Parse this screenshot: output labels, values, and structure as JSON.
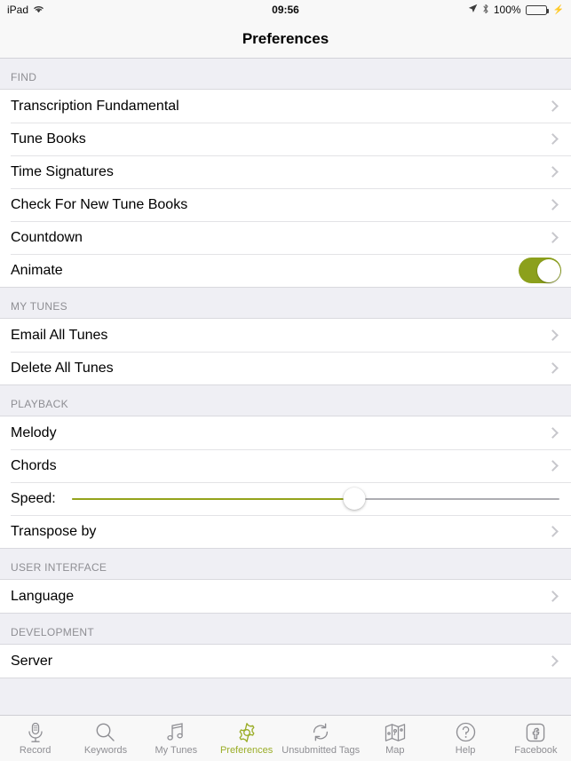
{
  "statusbar": {
    "device": "iPad",
    "wifi_icon": "wifi-icon",
    "time": "09:56",
    "location_icon": "location-arrow-icon",
    "bluetooth_icon": "bluetooth-icon",
    "battery_percent": "100%",
    "battery_icon": "battery-full-icon",
    "charging_icon": "lightning-bolt-icon"
  },
  "navbar": {
    "title": "Preferences"
  },
  "sections": [
    {
      "header": "FIND",
      "rows": [
        {
          "label": "Transcription Fundamental",
          "accessory": "chevron"
        },
        {
          "label": "Tune Books",
          "accessory": "chevron"
        },
        {
          "label": "Time Signatures",
          "accessory": "chevron"
        },
        {
          "label": "Check For New Tune Books",
          "accessory": "chevron"
        },
        {
          "label": "Countdown",
          "accessory": "chevron"
        },
        {
          "label": "Animate",
          "accessory": "toggle",
          "toggle_on": true
        }
      ]
    },
    {
      "header": "MY TUNES",
      "rows": [
        {
          "label": "Email All Tunes",
          "accessory": "chevron"
        },
        {
          "label": "Delete All Tunes",
          "accessory": "chevron"
        }
      ]
    },
    {
      "header": "PLAYBACK",
      "rows": [
        {
          "label": "Melody",
          "accessory": "chevron"
        },
        {
          "label": "Chords",
          "accessory": "chevron"
        },
        {
          "label": "Speed:",
          "accessory": "slider",
          "slider_percent": 58
        },
        {
          "label": "Transpose by",
          "accessory": "chevron"
        }
      ]
    },
    {
      "header": "USER INTERFACE",
      "rows": [
        {
          "label": "Language",
          "accessory": "chevron"
        }
      ]
    },
    {
      "header": "DEVELOPMENT",
      "rows": [
        {
          "label": "Server",
          "accessory": "chevron"
        }
      ]
    }
  ],
  "tabbar": {
    "active_index": 3,
    "items": [
      {
        "label": "Record",
        "icon": "microphone-icon"
      },
      {
        "label": "Keywords",
        "icon": "search-icon"
      },
      {
        "label": "My Tunes",
        "icon": "music-note-icon"
      },
      {
        "label": "Preferences",
        "icon": "gear-icon"
      },
      {
        "label": "Unsubmitted Tags",
        "icon": "sync-icon"
      },
      {
        "label": "Map",
        "icon": "map-icon"
      },
      {
        "label": "Help",
        "icon": "question-circle-icon"
      },
      {
        "label": "Facebook",
        "icon": "facebook-icon"
      }
    ]
  },
  "colors": {
    "accent": "#9aad27",
    "toggle_on": "#8ca01c",
    "slider_fill": "#94a31b",
    "group_background": "#efeff4",
    "row_background": "#ffffff",
    "battery_green": "#4cd964"
  }
}
